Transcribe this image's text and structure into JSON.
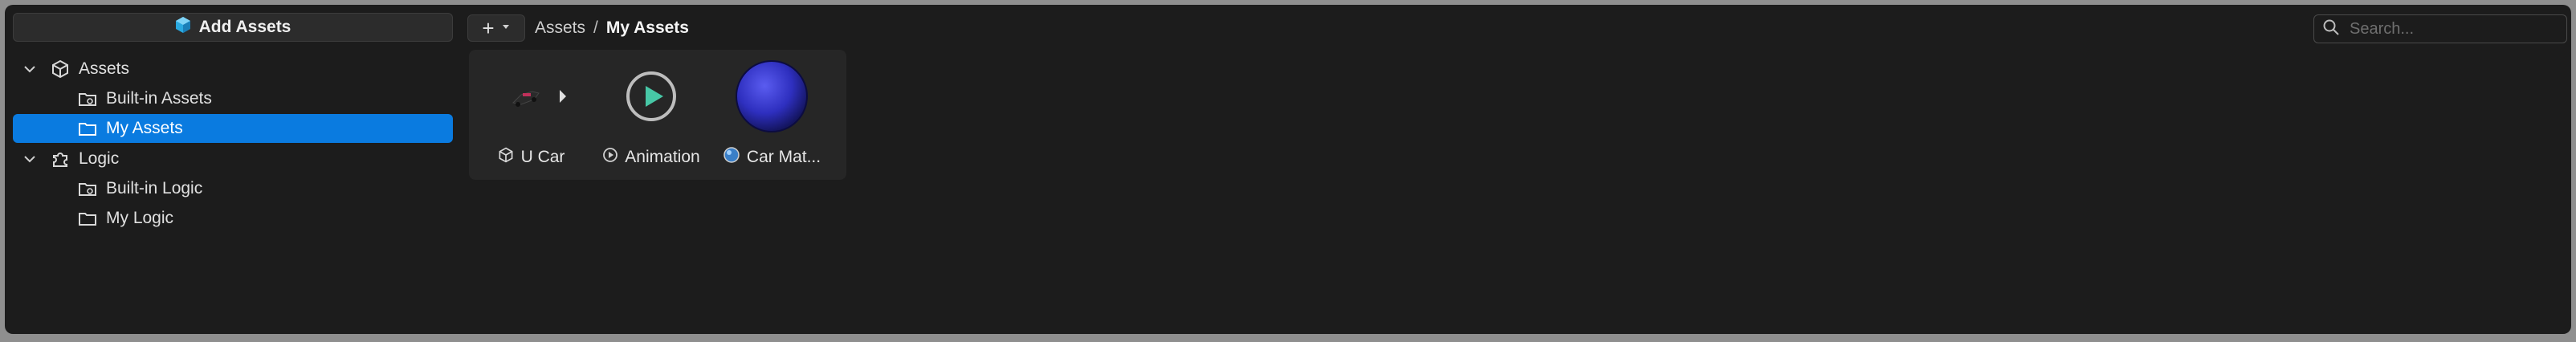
{
  "sidebar": {
    "add_assets_label": "Add Assets",
    "items": [
      {
        "label": "Assets",
        "icon": "cube-icon",
        "expanded": true
      },
      {
        "label": "Built-in Assets",
        "icon": "folder-gear-icon"
      },
      {
        "label": "My Assets",
        "icon": "folder-icon",
        "selected": true
      },
      {
        "label": "Logic",
        "icon": "puzzle-icon",
        "expanded": true
      },
      {
        "label": "Built-in Logic",
        "icon": "folder-gear-icon"
      },
      {
        "label": "My Logic",
        "icon": "folder-icon"
      }
    ]
  },
  "toolbar": {
    "plus_label": "+",
    "breadcrumb_root": "Assets",
    "breadcrumb_sep": "/",
    "breadcrumb_current": "My Assets"
  },
  "search": {
    "placeholder": "Search..."
  },
  "assets": [
    {
      "label": "U Car",
      "icon": "cube-icon"
    },
    {
      "label": "Animation",
      "icon": "play-icon"
    },
    {
      "label": "Car Mat...",
      "icon": "material-icon"
    }
  ],
  "colors": {
    "selection": "#0a7be0",
    "panel": "#1c1c1c",
    "accent_play": "#47c7a6",
    "material_sphere": "#2e2fbf"
  }
}
